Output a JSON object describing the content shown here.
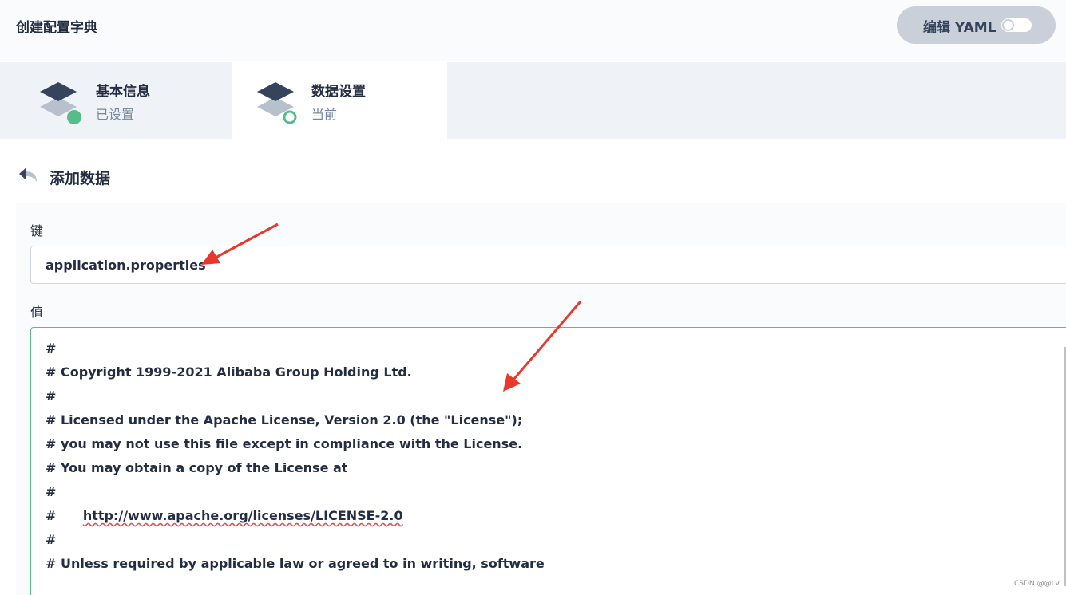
{
  "header": {
    "title": "创建配置字典",
    "yaml_toggle_label": "编辑 YAML"
  },
  "steps": [
    {
      "title": "基本信息",
      "status": "已设置"
    },
    {
      "title": "数据设置",
      "status": "当前"
    }
  ],
  "section": {
    "title": "添加数据"
  },
  "form": {
    "key_label": "键",
    "key_value": "application.properties",
    "value_label": "值",
    "value_lines": [
      "#",
      "# Copyright 1999-2021 Alibaba Group Holding Ltd.",
      "#",
      "# Licensed under the Apache License, Version 2.0 (the \"License\");",
      "# you may not use this file except in compliance with the License.",
      "# You may obtain a copy of the License at",
      "#",
      "#",
      "#",
      "# Unless required by applicable law or agreed to in writing, software"
    ],
    "url_line": {
      "prefix": "#      ",
      "url": "http://www.apache.org/licenses/LICENSE-2.0"
    }
  },
  "watermark": "CSDN @@Lv",
  "colors": {
    "accent_green": "#55bc8a",
    "annotation_red": "#e8372c",
    "text_dark": "#242e42",
    "step_icon_dark": "#36435c",
    "step_icon_light": "#b7c1ce"
  }
}
